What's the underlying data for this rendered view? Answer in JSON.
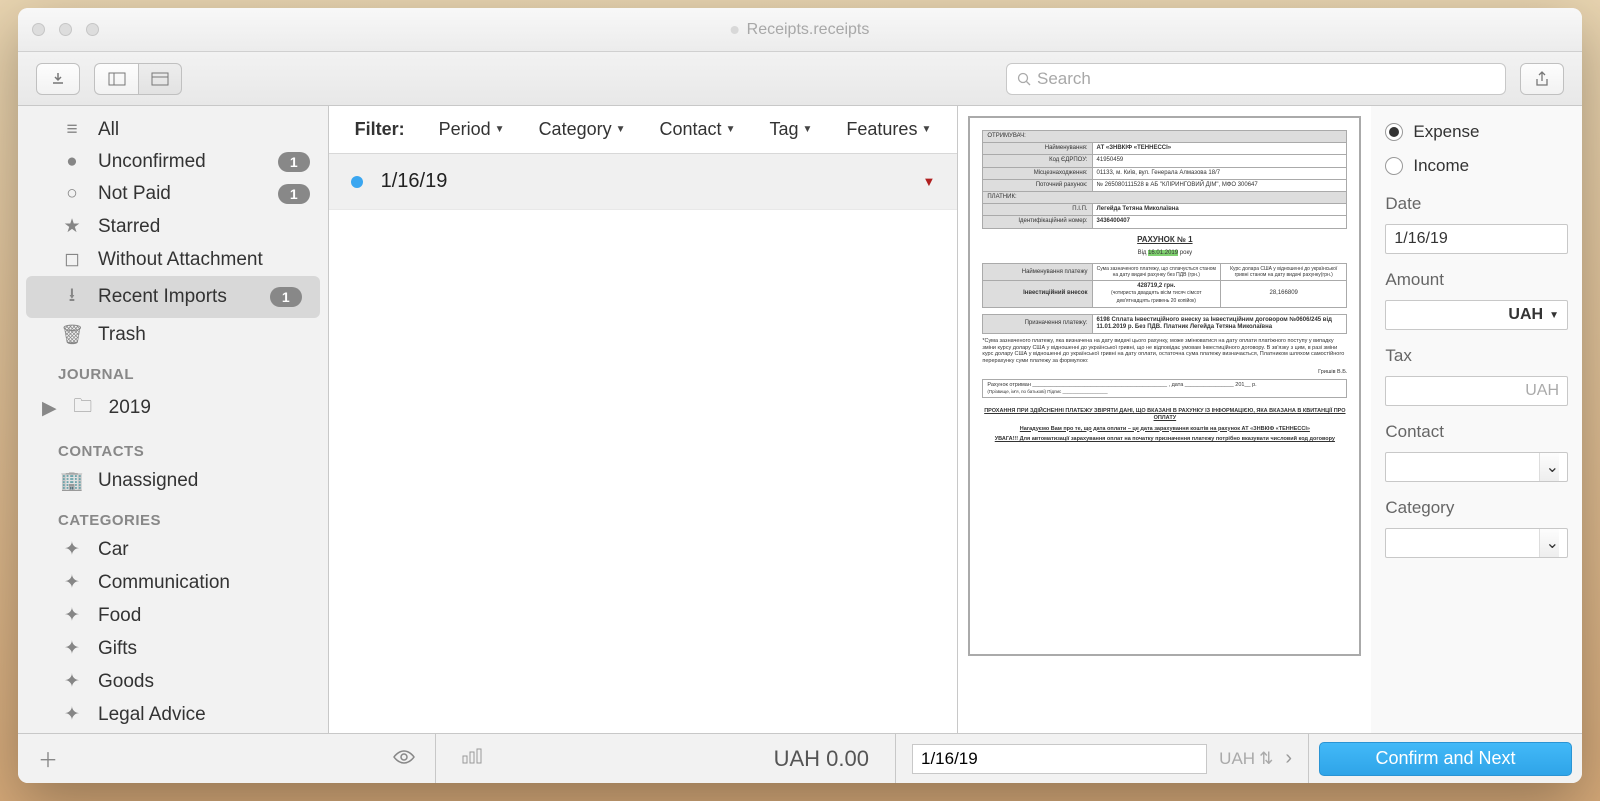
{
  "window": {
    "title": "Receipts.receipts"
  },
  "toolbar": {
    "search_placeholder": "Search"
  },
  "sidebar": {
    "items": [
      {
        "icon": "stack-icon",
        "label": "All"
      },
      {
        "icon": "dot-icon",
        "label": "Unconfirmed",
        "badge": "1"
      },
      {
        "icon": "circle-icon",
        "label": "Not Paid",
        "badge": "1"
      },
      {
        "icon": "star-icon",
        "label": "Starred"
      },
      {
        "icon": "dashed-box-icon",
        "label": "Without Attachment"
      },
      {
        "icon": "download-icon",
        "label": "Recent Imports",
        "badge": "1",
        "selected": true
      },
      {
        "icon": "trash-icon",
        "label": "Trash"
      }
    ],
    "journal": {
      "header": "JOURNAL",
      "items": [
        {
          "label": "2019"
        }
      ]
    },
    "contacts": {
      "header": "CONTACTS",
      "items": [
        {
          "label": "Unassigned"
        }
      ]
    },
    "categories": {
      "header": "CATEGORIES",
      "items": [
        {
          "label": "Car"
        },
        {
          "label": "Communication"
        },
        {
          "label": "Food"
        },
        {
          "label": "Gifts"
        },
        {
          "label": "Goods"
        },
        {
          "label": "Legal Advice"
        }
      ]
    }
  },
  "filter": {
    "label": "Filter:",
    "items": [
      "Period",
      "Category",
      "Contact",
      "Tag",
      "Features"
    ]
  },
  "list": [
    {
      "date": "1/16/19",
      "unread": true,
      "flag": true
    }
  ],
  "footer": {
    "total": "UAH 0.00",
    "date": "1/16/19",
    "currency": "UAH"
  },
  "details": {
    "type_expense": "Expense",
    "type_income": "Income",
    "date_label": "Date",
    "date": "1/16/19",
    "amount_label": "Amount",
    "amount_currency": "UAH",
    "tax_label": "Tax",
    "tax_currency": "UAH",
    "contact_label": "Contact",
    "category_label": "Category",
    "confirm": "Confirm and Next"
  },
  "doc": {
    "r1": "ОТРИМУВАЧ:",
    "r2l": "Найменування:",
    "r2v": "АТ «ЗНВКІФ «ТЕННЕССІ»",
    "r3l": "Код ЄДРПОУ:",
    "r3v": "41950459",
    "r4l": "Місцезнаходження:",
    "r4v": "01133, м. Київ, вул. Генерала Алмазова 18/7",
    "r5l": "Поточний рахунок:",
    "r5v": "№ 265080111528 в АБ \"КЛІРИНГОВИЙ ДІМ\", МФО 300647",
    "r6": "ПЛАТНИК:",
    "r7l": "П.І.П.",
    "r7v": "Легейда Тетяна Миколаївна",
    "r8l": "Ідентифікаційний номер:",
    "r8v": "3436400407",
    "title": "РАХУНОК № 1",
    "dfrom": "Від",
    "ddate": "16.01.2019",
    "dyear": "року",
    "t1": "Найменування платежу",
    "t2": "Сума зазначеного платежу, що сплачується станом на дату видачі рахунку без ПДВ (грн.)",
    "t3": "Курс долара США у відношенні до української гривні станом на дату видачі рахунку(грн.)",
    "u1": "Інвестиційний внесок",
    "u2": "428719,2 грн.",
    "u2s": "(чотириста двадцять вісім тисяч сімсот дев'ятнадцять гривень 20 копійок)",
    "u3": "28,166809",
    "p1": "Призначення платежу:",
    "p2": "6198 Сплата Інвестиційного внеску за Інвестиційним договором №0606/245 від 11.01.2019 р. Без ПДВ. Платник Легейда Тетяна Миколаївна",
    "note": "*Сума зазначеного платежу, яка визначена на дату видачі цього рахунку, може змінюватися на дату оплати платіжного поступу у випадку зміни курсу долару США у відношенні до української гривні, що не відповідає умовам Інвестиційного договору. В зв'язку з цим, в разі зміни курс долару США у відношенні до української гривні на дату оплати, остаточна сума платежу визначається, Платником шляхом самостійного перерахунку суми платежу за формулою:",
    "sign": "Гришів В.Б.",
    "line1": "Рахунок отриман ____________________________________________ , дата ________________ 201__ р.",
    "line2": "(Прізвище, ім'я, по батькові)                                                                                    Підпис __________________",
    "warn1": "ПРОХАННЯ ПРИ ЗДІЙСНЕННІ ПЛАТЕЖУ ЗВІРЯТИ ДАНІ, ЩО ВКАЗАНІ В РАХУНКУ ІЗ ІНФОРМАЦІЄЮ, ЯКА ВКАЗАНА В КВИТАНЦІЇ ПРО ОПЛАТУ",
    "warn2": "Нагадуємо Вам про те, що дата оплати – це дата зарахування коштів на рахунок АТ «ЗНВКІФ «ТЕННЕССІ»",
    "warn3": "УВАГА!!! Для автоматизації зарахування оплат на початку призначення платежу потрібно вказувати числовий код договору"
  }
}
